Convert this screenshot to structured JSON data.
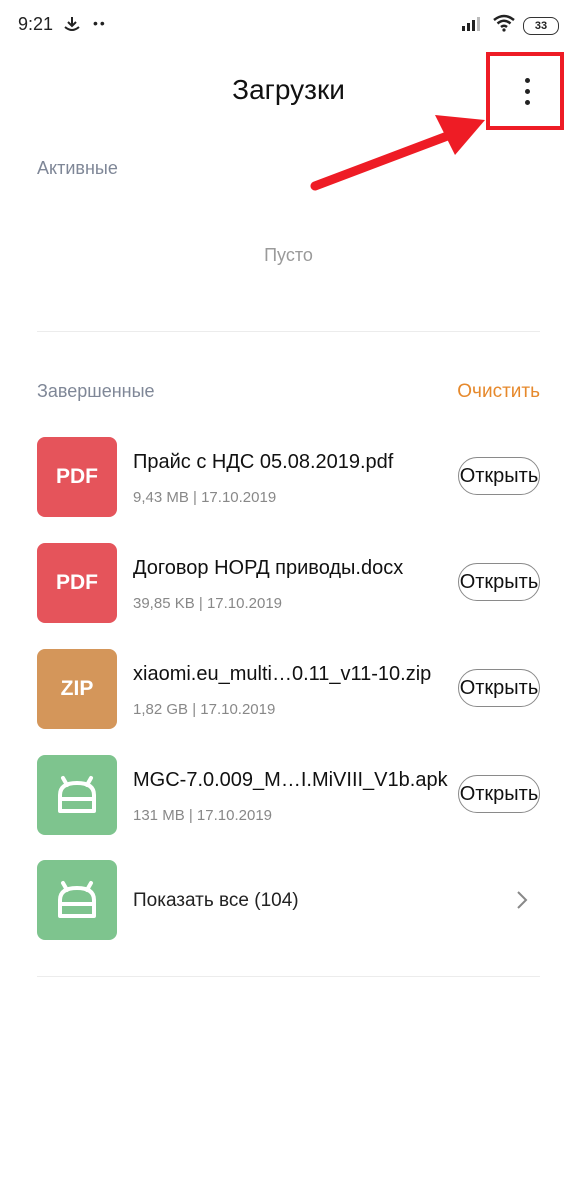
{
  "status_bar": {
    "time": "9:21",
    "dots": "••",
    "battery": "33"
  },
  "header": {
    "title": "Загрузки"
  },
  "active": {
    "label": "Активные",
    "empty_text": "Пусто"
  },
  "completed": {
    "label": "Завершенные",
    "clear_label": "Очистить",
    "items": [
      {
        "icon_text": "PDF",
        "icon_color": "#e5545b",
        "name": "Прайс с НДС 05.08.2019.pdf",
        "meta": "9,43 MB | 17.10.2019",
        "open_label": "Открыть"
      },
      {
        "icon_text": "PDF",
        "icon_color": "#e5545b",
        "name": "Договор НОРД приводы.docx",
        "meta": "39,85 KB | 17.10.2019",
        "open_label": "Открыть"
      },
      {
        "icon_text": "ZIP",
        "icon_color": "#d4965a",
        "name": "xiaomi.eu_multi…0.11_v11-10.zip",
        "meta": "1,82 GB | 17.10.2019",
        "open_label": "Открыть"
      },
      {
        "icon_text": "",
        "icon_color": "#7ec48e",
        "name": "MGC-7.0.009_M…I.MiVIII_V1b.apk",
        "meta": "131 MB | 17.10.2019",
        "open_label": "Открыть"
      }
    ],
    "show_all": {
      "label": "Показать все (104)",
      "icon_color": "#7ec48e"
    }
  },
  "colors": {
    "accent_orange": "#e6892c",
    "highlight_red": "#ee1c25"
  }
}
